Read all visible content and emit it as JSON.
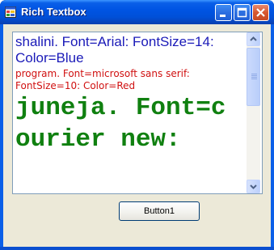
{
  "window": {
    "title": "Rich Textbox",
    "icon": "app-window-icon",
    "controls": [
      "minimize-icon",
      "maximize-icon",
      "close-icon"
    ]
  },
  "richtextbox": {
    "lines": [
      "shalini. Font=Arial: FontSize=14: Color=Blue",
      "program. Font=microsoft sans serif: FontSize=10: Color=Red",
      "juneja. Font=courier new:"
    ],
    "colors": [
      "#1a1ab8",
      "#d01010",
      "#108010"
    ]
  },
  "button": {
    "label": "Button1"
  }
}
